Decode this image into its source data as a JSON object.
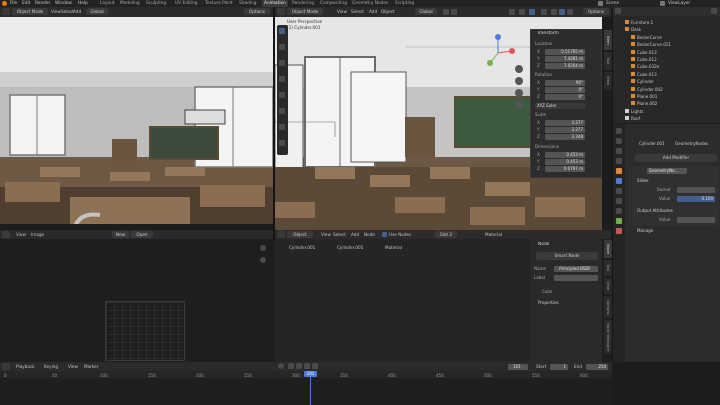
{
  "menu": {
    "items": [
      "File",
      "Edit",
      "Render",
      "Window",
      "Help"
    ],
    "workspaces": [
      "Layout",
      "Modeling",
      "Sculpting",
      "UV Editing",
      "Texture Paint",
      "Shading",
      "Animation",
      "Rendering",
      "Compositing",
      "Geometry Nodes",
      "Scripting"
    ],
    "active_workspace": "Animation",
    "scene_label": "Scene",
    "viewlayer_label": "ViewLayer"
  },
  "left_view": {
    "mode": "Object Mode",
    "menus": [
      "View",
      "Select",
      "Add",
      "Object"
    ],
    "orientation": "Global",
    "options": "Options"
  },
  "main_view": {
    "mode": "Object Mode",
    "menus": [
      "View",
      "Select",
      "Add",
      "Object"
    ],
    "orientation": "Global",
    "options": "Options",
    "overlay_title": "User Perspective",
    "overlay_sub": "(1) Cylinder.001"
  },
  "transform_panel": {
    "title": "Transform",
    "location_label": "Location",
    "location": [
      {
        "axis": "X",
        "value": "0.51765 m"
      },
      {
        "axis": "Y",
        "value": "7.4281 m"
      },
      {
        "axis": "Z",
        "value": "7.0204 m"
      }
    ],
    "rotation_label": "Rotation",
    "rotation": [
      {
        "axis": "X",
        "value": "90°"
      },
      {
        "axis": "Y",
        "value": "0°"
      },
      {
        "axis": "Z",
        "value": "0°"
      }
    ],
    "rotation_mode": "XYZ Euler",
    "scale_label": "Scale",
    "scale": [
      {
        "axis": "X",
        "value": "3.277"
      },
      {
        "axis": "Y",
        "value": "3.277"
      },
      {
        "axis": "Z",
        "value": "3.348"
      }
    ],
    "dimensions_label": "Dimensions",
    "dimensions": [
      {
        "axis": "X",
        "value": "0.453 m"
      },
      {
        "axis": "Y",
        "value": "0.453 m"
      },
      {
        "axis": "Z",
        "value": "0.0797 m"
      }
    ]
  },
  "n_tabs": [
    "Item",
    "Tool",
    "View"
  ],
  "node_tabs": [
    "Node",
    "Tool",
    "View",
    "Options",
    "Node Wrangler"
  ],
  "node_editor": {
    "menus": [
      "Object",
      "View",
      "Select",
      "Add",
      "Node"
    ],
    "use_nodes": "Use Nodes",
    "slot": "Slot 2",
    "material": "Material",
    "breadcrumbs": [
      "Cylinder.001",
      "Cylinder.005",
      "Material"
    ],
    "node_panel_title": "Node",
    "node_button": "Smart Node",
    "name_label": "Name",
    "name_value": "Principled BSDF",
    "label_label": "Label",
    "color_section": "Color",
    "properties_section": "Properties"
  },
  "image_editor": {
    "menus": [
      "View",
      "Image"
    ],
    "new_btn": "New",
    "open_btn": "Open"
  },
  "outliner": {
    "items": [
      {
        "name": "Furniture.1",
        "indent": 1,
        "color": "#d88a3a"
      },
      {
        "name": "Desk",
        "indent": 1,
        "color": "#d88a3a"
      },
      {
        "name": "BezierCurve",
        "indent": 2,
        "color": "#d88a3a"
      },
      {
        "name": "BezierCurve.011",
        "indent": 2,
        "color": "#d88a3a"
      },
      {
        "name": "Cube.013",
        "indent": 2,
        "color": "#d88a3a"
      },
      {
        "name": "Cube.012",
        "indent": 2,
        "color": "#d88a3a"
      },
      {
        "name": "Cube.032e",
        "indent": 2,
        "color": "#d88a3a"
      },
      {
        "name": "Cube.013",
        "indent": 2,
        "color": "#d88a3a"
      },
      {
        "name": "Cylinder",
        "indent": 2,
        "color": "#d88a3a"
      },
      {
        "name": "Cylinder.002",
        "indent": 2,
        "color": "#d88a3a"
      },
      {
        "name": "Plane.001",
        "indent": 2,
        "color": "#d88a3a"
      },
      {
        "name": "Plane.002",
        "indent": 2,
        "color": "#d88a3a"
      },
      {
        "name": "Lights",
        "indent": 1,
        "color": "#cfcfcf"
      },
      {
        "name": "Roof",
        "indent": 1,
        "color": "#cfcfcf"
      }
    ]
  },
  "properties": {
    "object_name": "Cylinder.001",
    "modifier_name": "GeometryNodes",
    "add_modifier": "Add Modifier",
    "gn_name": "GeometryNo...",
    "slider_label": "Slider",
    "socket_label": "Socket",
    "value_label": "Value",
    "value": "0.100",
    "output_attributes": "Output Attributes",
    "output_value_label": "Value",
    "manage_label": "Manage"
  },
  "timeline": {
    "menus": [
      "Playback",
      "Keying",
      "View",
      "Marker"
    ],
    "current_frame": "101",
    "start_label": "Start",
    "start": "1",
    "end_label": "End",
    "end": "250",
    "ticks": [
      "0",
      "50",
      "100",
      "150",
      "200",
      "250",
      "300",
      "350",
      "400",
      "450",
      "500",
      "550",
      "600"
    ],
    "playhead": "101"
  }
}
